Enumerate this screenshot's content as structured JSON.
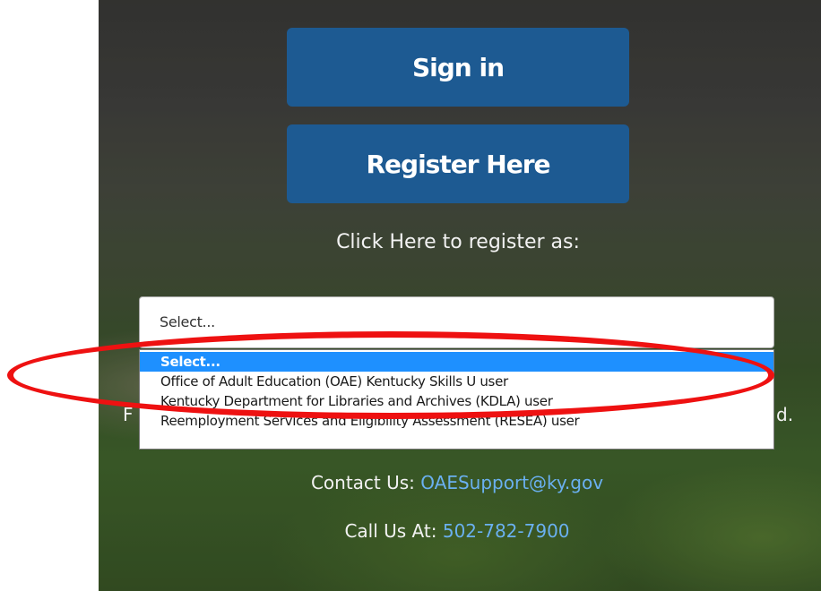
{
  "buttons": {
    "sign_in": "Sign in",
    "register": "Register Here"
  },
  "register_as_label": "Click Here to register as:",
  "role_select": {
    "selected_value": "Select...",
    "options": [
      "Select...",
      "Office of Adult Education (OAE) Kentucky Skills U user",
      "Kentucky Department for Libraries and Archives (KDLA) user",
      "Reemployment Services and Eligibility Assessment (RESEA) user"
    ],
    "highlighted_option_color": "#1e90ff"
  },
  "obscured_text": {
    "left_fragment": "F",
    "right_fragment": "d."
  },
  "contact": {
    "label": "Contact Us:",
    "email": "OAESupport@ky.gov"
  },
  "call": {
    "label": "Call Us At:",
    "phone": "502-782-7900"
  },
  "colors": {
    "button_blue": "#1d5a92",
    "link_blue": "#6ab0f0",
    "annotation_red": "#ee1111"
  }
}
